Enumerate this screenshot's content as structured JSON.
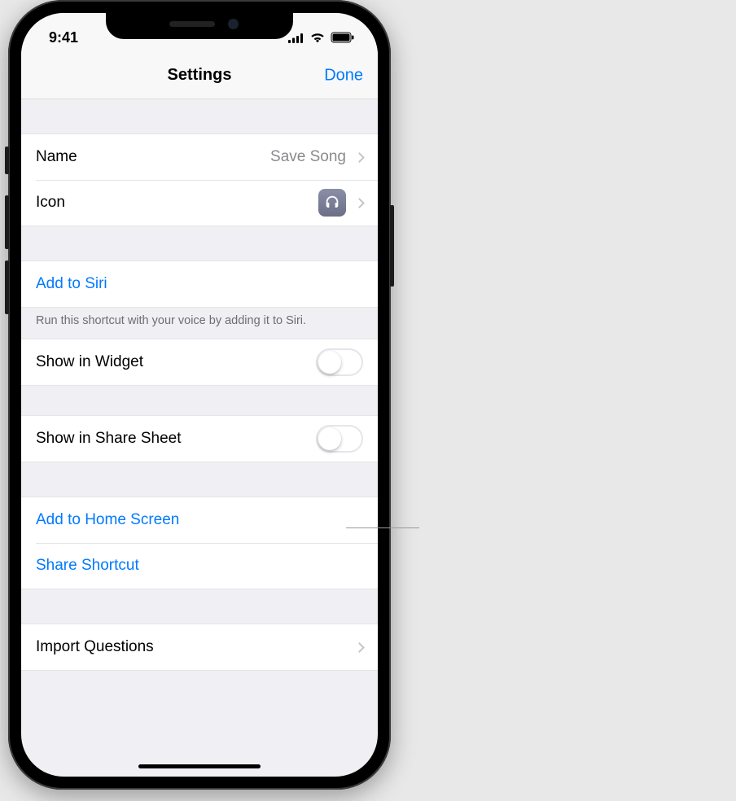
{
  "status": {
    "time": "9:41"
  },
  "nav": {
    "title": "Settings",
    "done": "Done"
  },
  "name_row": {
    "label": "Name",
    "value": "Save Song"
  },
  "icon_row": {
    "label": "Icon",
    "icon_name": "headphones-icon"
  },
  "siri": {
    "add": "Add to Siri",
    "footer": "Run this shortcut with your voice by adding it to Siri."
  },
  "widget": {
    "label": "Show in Widget",
    "on": false
  },
  "share_sheet": {
    "label": "Show in Share Sheet",
    "on": false
  },
  "actions": {
    "home_screen": "Add to Home Screen",
    "share_shortcut": "Share Shortcut"
  },
  "import": {
    "label": "Import Questions"
  }
}
